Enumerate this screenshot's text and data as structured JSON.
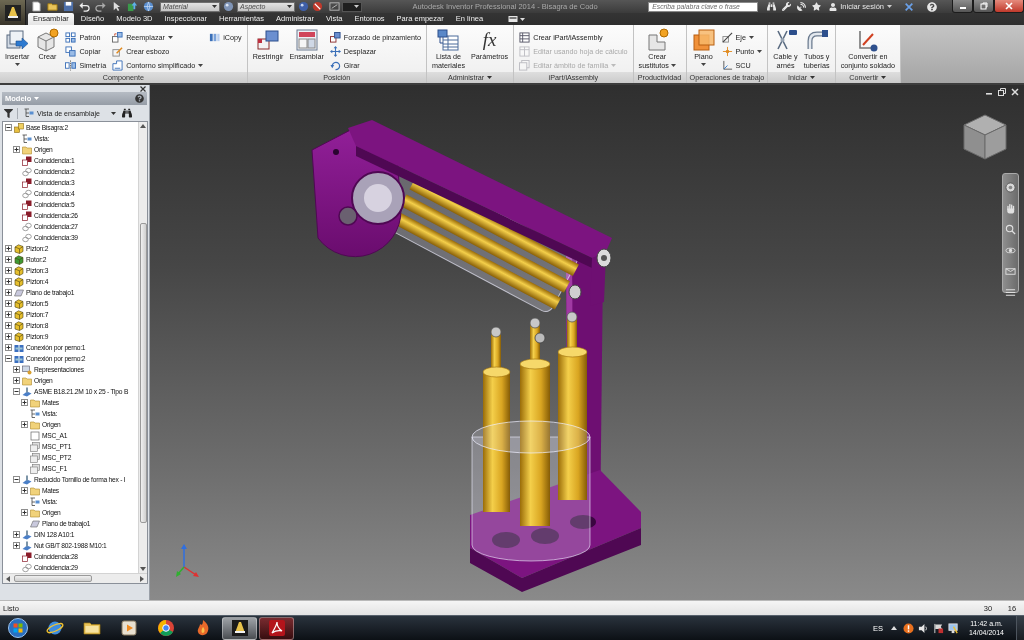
{
  "title_bar": {
    "title": "Autodesk Inventor Professional 2014 - Bisagra de Codo",
    "material": {
      "value": "Material",
      "disabled": true
    },
    "appearance": {
      "value": "Aspecto",
      "disabled": true
    },
    "search": {
      "placeholder": "Escriba palabra clave o frase"
    },
    "sign_in": "Iniciar sesión"
  },
  "ribbon_tabs": [
    {
      "label": "Ensamblar",
      "selected": true
    },
    {
      "label": "Diseño",
      "selected": false
    },
    {
      "label": "Modelo 3D",
      "selected": false
    },
    {
      "label": "Inspeccionar",
      "selected": false
    },
    {
      "label": "Herramientas",
      "selected": false
    },
    {
      "label": "Administrar",
      "selected": false
    },
    {
      "label": "Vista",
      "selected": false
    },
    {
      "label": "Entornos",
      "selected": false
    },
    {
      "label": "Para empezar",
      "selected": false
    },
    {
      "label": "En línea",
      "selected": false
    }
  ],
  "ribbon_panels": [
    {
      "title": "Componente",
      "menu": false,
      "groups": [
        {
          "kind": "large",
          "label": "Insertar",
          "menu": true,
          "disabled": false
        },
        {
          "kind": "large",
          "label": "Crear",
          "menu": false,
          "disabled": false
        },
        {
          "kind": "stack",
          "tools": [
            {
              "label": "Patrón",
              "menu": false,
              "disabled": false
            },
            {
              "label": "Copiar",
              "menu": false,
              "disabled": false
            },
            {
              "label": "Simetría",
              "menu": false,
              "disabled": false
            }
          ]
        },
        {
          "kind": "stack",
          "tools": [
            {
              "label": "Reemplazar",
              "menu": true,
              "disabled": false
            },
            {
              "label": "Crear esbozo",
              "menu": false,
              "disabled": false
            },
            {
              "label": "Contorno simplificado",
              "menu": true,
              "disabled": false
            }
          ]
        },
        {
          "kind": "stack",
          "tools": [
            {
              "label": "iCopy",
              "menu": false,
              "disabled": false
            }
          ]
        }
      ]
    },
    {
      "title": "Posición",
      "menu": false,
      "groups": [
        {
          "kind": "large",
          "label": "Restringir",
          "menu": false,
          "disabled": false
        },
        {
          "kind": "large",
          "label": "Ensamblar",
          "menu": false,
          "disabled": false
        },
        {
          "kind": "stack",
          "tools": [
            {
              "label": "Forzado de pinzamiento",
              "menu": false,
              "disabled": false
            },
            {
              "label": "Desplazar",
              "menu": false,
              "disabled": false
            },
            {
              "label": "Girar",
              "menu": false,
              "disabled": false
            }
          ]
        }
      ]
    },
    {
      "title": "Administrar",
      "menu": true,
      "groups": [
        {
          "kind": "large",
          "label": "Lista de\nmateriales",
          "menu": false,
          "disabled": false
        },
        {
          "kind": "large",
          "label": "Parámetros",
          "glyph": "fx",
          "menu": false,
          "disabled": false
        }
      ]
    },
    {
      "title": "iPart/iAssembly",
      "menu": false,
      "groups": [
        {
          "kind": "stack",
          "tools": [
            {
              "label": "Crear iPart/iAssembly",
              "menu": false,
              "disabled": false
            },
            {
              "label": "Editar usando hoja de cálculo",
              "menu": false,
              "disabled": true
            },
            {
              "label": "Editar ámbito de familia",
              "menu": true,
              "disabled": true
            }
          ]
        }
      ]
    },
    {
      "title": "Productividad",
      "menu": false,
      "groups": [
        {
          "kind": "large",
          "label": "Crear\nsustitutos",
          "menu": true,
          "disabled": false
        }
      ]
    },
    {
      "title": "Operaciones de trabajo",
      "menu": false,
      "groups": [
        {
          "kind": "large",
          "label": "Plano",
          "menu": true,
          "disabled": false
        },
        {
          "kind": "stack",
          "tools": [
            {
              "label": "Eje",
              "menu": true,
              "disabled": false
            },
            {
              "label": "Punto",
              "menu": true,
              "disabled": false
            },
            {
              "label": "SCU",
              "menu": false,
              "disabled": false
            }
          ]
        }
      ]
    },
    {
      "title": "Iniciar",
      "menu": true,
      "groups": [
        {
          "kind": "large",
          "label": "Cable y\narnés",
          "menu": false,
          "disabled": false
        },
        {
          "kind": "large",
          "label": "Tubos y\ntuberías",
          "menu": false,
          "disabled": false
        }
      ]
    },
    {
      "title": "Convertir",
      "menu": true,
      "groups": [
        {
          "kind": "large",
          "label": "Convertir en\nconjunto soldado",
          "menu": false,
          "disabled": false
        }
      ]
    }
  ],
  "browser": {
    "title": "Modelo",
    "view": "Vista de ensamblaje",
    "tree": [
      {
        "label": "Base Bisagra:2",
        "kind": "assembly",
        "expanded": true,
        "children": [
          {
            "label": "Vista:",
            "kind": "view"
          },
          {
            "label": "Origen",
            "kind": "folder",
            "expanded": false
          },
          {
            "label": "Coincidencia:1",
            "kind": "mate"
          },
          {
            "label": "Coincidencia:2",
            "kind": "insert"
          },
          {
            "label": "Coincidencia:3",
            "kind": "mate"
          },
          {
            "label": "Coincidencia:4",
            "kind": "insert"
          },
          {
            "label": "Coincidencia:5",
            "kind": "mate"
          },
          {
            "label": "Coincidencia:26",
            "kind": "mate"
          },
          {
            "label": "Coincidencia:27",
            "kind": "insert"
          },
          {
            "label": "Coincidencia:39",
            "kind": "insert"
          }
        ]
      },
      {
        "label": "Pizton:2",
        "kind": "part",
        "color": "#e6bf2e",
        "expanded": false
      },
      {
        "label": "Rotor:2",
        "kind": "part",
        "color": "#3f9a35",
        "expanded": false
      },
      {
        "label": "Pizton:3",
        "kind": "part",
        "color": "#e6bf2e",
        "expanded": false
      },
      {
        "label": "Pizton:4",
        "kind": "part",
        "color": "#e6bf2e",
        "expanded": false
      },
      {
        "label": "Plano de trabajo1",
        "kind": "plane",
        "expanded": false
      },
      {
        "label": "Pizton:5",
        "kind": "part",
        "color": "#e6bf2e",
        "expanded": false
      },
      {
        "label": "Pizton:7",
        "kind": "part",
        "color": "#e6bf2e",
        "expanded": false
      },
      {
        "label": "Pizton:8",
        "kind": "part",
        "color": "#e6bf2e",
        "expanded": false
      },
      {
        "label": "Pizton:9",
        "kind": "part",
        "color": "#e6bf2e",
        "expanded": false
      },
      {
        "label": "Conexión por perno:1",
        "kind": "connection",
        "expanded": false
      },
      {
        "label": "Conexión por perno:2",
        "kind": "connection",
        "expanded": true,
        "children": [
          {
            "label": "Representaciones",
            "kind": "representations",
            "expanded": false
          },
          {
            "label": "Origen",
            "kind": "folder",
            "expanded": false
          },
          {
            "label": "ASME B18.21.2M 10 x 25 - Tipo B",
            "kind": "content",
            "expanded": true,
            "children": [
              {
                "label": "Mates",
                "kind": "folder",
                "expanded": false
              },
              {
                "label": "Vista:",
                "kind": "view"
              },
              {
                "label": "Origen",
                "kind": "folder",
                "expanded": false
              },
              {
                "label": "MSC_A1",
                "kind": "sketch"
              },
              {
                "label": "MSC_PT1",
                "kind": "surface"
              },
              {
                "label": "MSC_PT2",
                "kind": "surface"
              },
              {
                "label": "MSC_F1",
                "kind": "surface"
              }
            ]
          },
          {
            "label": "Reducido Tornillo de forma hex - I",
            "kind": "content",
            "expanded": true,
            "children": [
              {
                "label": "Mates",
                "kind": "folder",
                "expanded": false
              },
              {
                "label": "Vista:",
                "kind": "view"
              },
              {
                "label": "Origen",
                "kind": "folder",
                "expanded": false
              },
              {
                "label": "Plano de trabajo1",
                "kind": "plane"
              }
            ]
          },
          {
            "label": "DIN 128 A10:1",
            "kind": "content",
            "expanded": false
          },
          {
            "label": "Nut GB/T 802-1988 M10:1",
            "kind": "content",
            "expanded": false
          },
          {
            "label": "Coincidencia:28",
            "kind": "mate"
          },
          {
            "label": "Coincidencia:29",
            "kind": "insert"
          }
        ]
      }
    ]
  },
  "status_bar": {
    "message": "Listo",
    "readout_1": "30",
    "readout_2": "16"
  },
  "taskbar": {
    "apps": [
      {
        "running": false,
        "selected": false
      },
      {
        "running": false,
        "selected": false
      },
      {
        "running": false,
        "selected": false
      },
      {
        "running": false,
        "selected": false
      },
      {
        "running": false,
        "selected": false
      },
      {
        "running": true,
        "selected": true
      },
      {
        "running": true,
        "selected": false
      }
    ],
    "language": "ES",
    "time": "11:42 a.m.",
    "date": "14/04/2014"
  }
}
